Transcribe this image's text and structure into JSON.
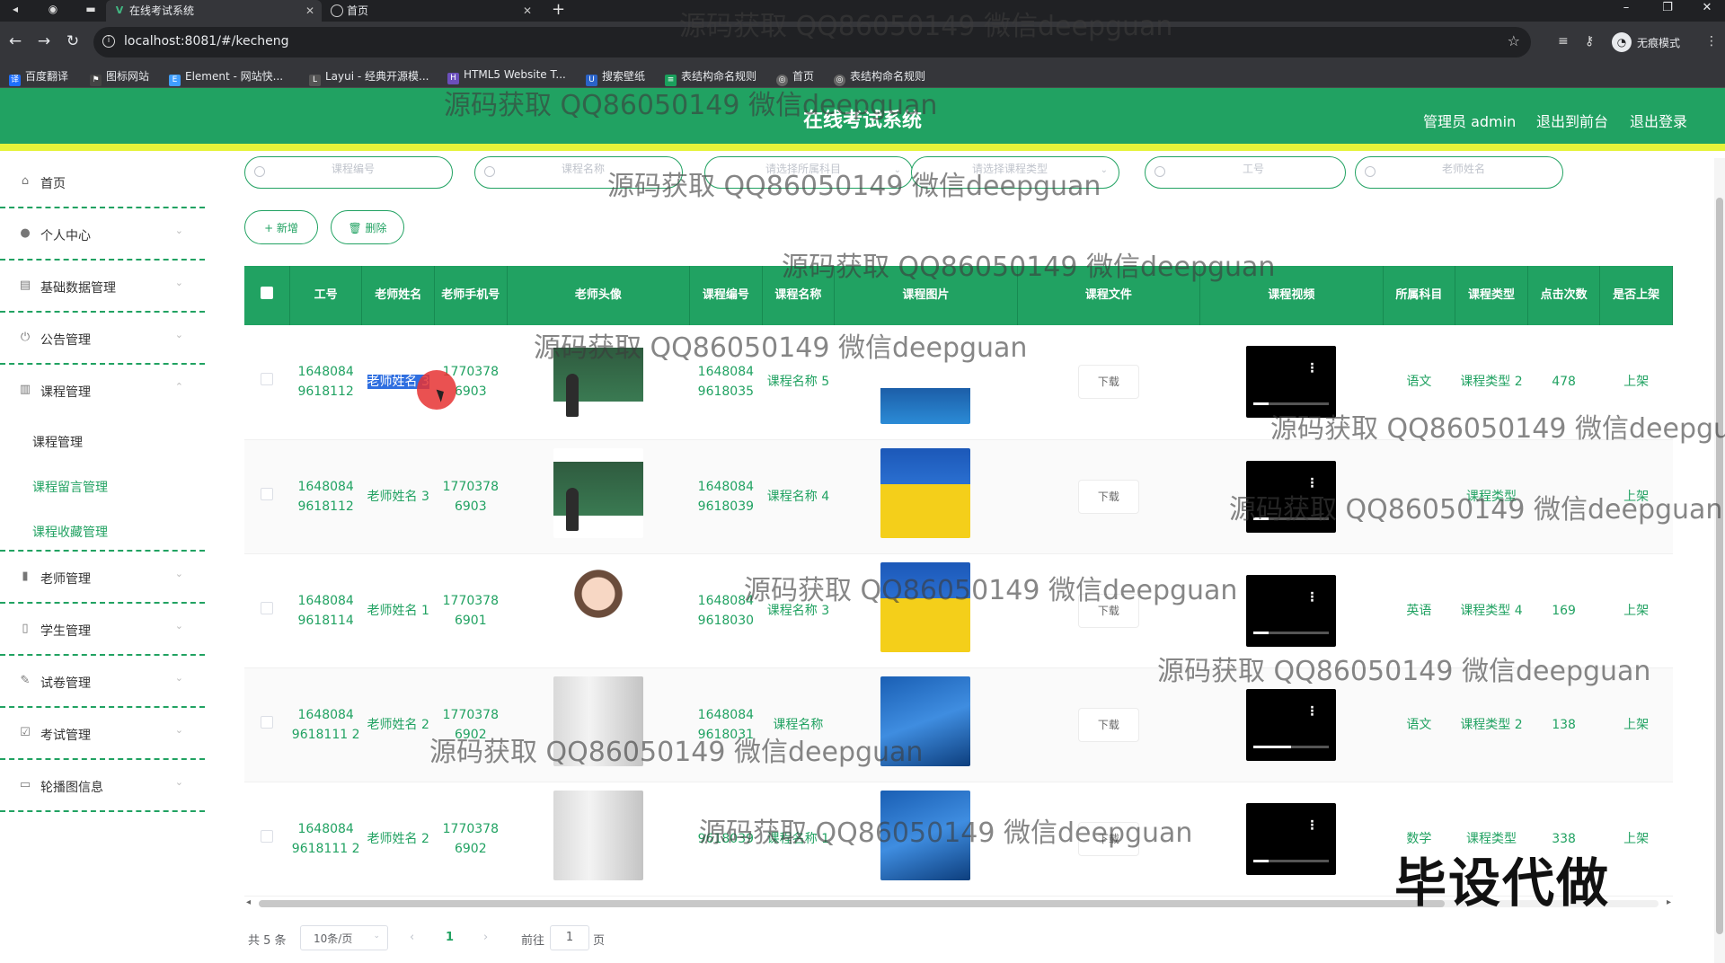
{
  "browser": {
    "tabs": [
      {
        "title": "在线考试系统",
        "active": true
      },
      {
        "title": "首页",
        "active": false
      }
    ],
    "url": "localhost:8081/#/kecheng",
    "profile_label": "无痕模式",
    "bookmarks": [
      "百度翻译",
      "图标网站",
      "Element - 网站快...",
      "Layui - 经典开源模...",
      "HTML5 Website T...",
      "搜索壁纸",
      "表结构命名规则",
      "首页",
      "表结构命名规则"
    ]
  },
  "header": {
    "title": "在线考试系统",
    "user_label": "管理员 admin",
    "to_front": "退出到前台",
    "logout": "退出登录"
  },
  "sidebar": {
    "items": [
      {
        "label": "首页",
        "icon": "home-icon",
        "has_arrow": false
      },
      {
        "label": "个人中心",
        "icon": "user-icon",
        "has_arrow": true
      },
      {
        "label": "基础数据管理",
        "icon": "database-icon",
        "has_arrow": true
      },
      {
        "label": "公告管理",
        "icon": "power-icon",
        "has_arrow": true
      },
      {
        "label": "课程管理",
        "icon": "clipboard-icon",
        "has_arrow": true,
        "expanded": true
      }
    ],
    "sub_items": [
      "课程管理",
      "课程留言管理",
      "课程收藏管理"
    ],
    "items_after": [
      {
        "label": "老师管理",
        "icon": "bar-chart-icon"
      },
      {
        "label": "学生管理",
        "icon": "student-icon"
      },
      {
        "label": "试卷管理",
        "icon": "edit-icon"
      },
      {
        "label": "考试管理",
        "icon": "checklist-icon"
      },
      {
        "label": "轮播图信息",
        "icon": "monitor-icon"
      }
    ]
  },
  "search": {
    "course_no_placeholder": "课程编号",
    "course_name_placeholder": "课程名称",
    "subject_placeholder": "请选择所属科目",
    "type_placeholder": "请选择课程类型",
    "teacher_no_placeholder": "工号",
    "teacher_name_placeholder": "老师姓名"
  },
  "actions": {
    "add": "+ 新增",
    "delete": "删除"
  },
  "table": {
    "headers": [
      "工号",
      "老师姓名",
      "老师手机号",
      "老师头像",
      "课程编号",
      "课程名称",
      "课程图片",
      "课程文件",
      "课程视频",
      "所属科目",
      "课程类型",
      "点击次数",
      "是否上架"
    ],
    "download_label": "下载",
    "rows": [
      {
        "work_no": "1648084 9618112",
        "teacher_name": "老师姓名 3",
        "phone": "1770378 6903",
        "course_no": "1648084 9618035",
        "course_name": "课程名称 5",
        "subject": "语文",
        "course_type": "课程类型 2",
        "clicks": "478",
        "status": "上架"
      },
      {
        "work_no": "1648084 9618112",
        "teacher_name": "老师姓名 3",
        "phone": "1770378 6903",
        "course_no": "1648084 9618039",
        "course_name": "课程名称 4",
        "subject": "",
        "course_type": "课程类型",
        "clicks": "",
        "status": "上架"
      },
      {
        "work_no": "1648084 9618114",
        "teacher_name": "老师姓名 1",
        "phone": "1770378 6901",
        "course_no": "1648084 9618030",
        "course_name": "课程名称 3",
        "subject": "英语",
        "course_type": "课程类型 4",
        "clicks": "169",
        "status": "上架"
      },
      {
        "work_no": "1648084 9618111 2",
        "teacher_name": "老师姓名 2",
        "phone": "1770378 6902",
        "course_no": "1648084 9618031",
        "course_name": "课程名称",
        "subject": "语文",
        "course_type": "课程类型 2",
        "clicks": "138",
        "status": "上架"
      },
      {
        "work_no": "1648084 9618111 2",
        "teacher_name": "老师姓名 2",
        "phone": "1770378 6902",
        "course_no": "9618039",
        "course_name": "课程名称 1",
        "subject": "数学",
        "course_type": "课程类型",
        "clicks": "338",
        "status": "上架"
      }
    ]
  },
  "pagination": {
    "total": "共 5 条",
    "page_size": "10条/页",
    "current_page": "1",
    "goto_prefix": "前往",
    "goto_value": "1",
    "goto_suffix": "页"
  },
  "overlay": {
    "watermark": "源码获取 QQ86050149 微信deepguan",
    "stamp": "毕设代做"
  },
  "colors": {
    "primary": "#21a262",
    "accent_bar": "#e6f33a"
  }
}
